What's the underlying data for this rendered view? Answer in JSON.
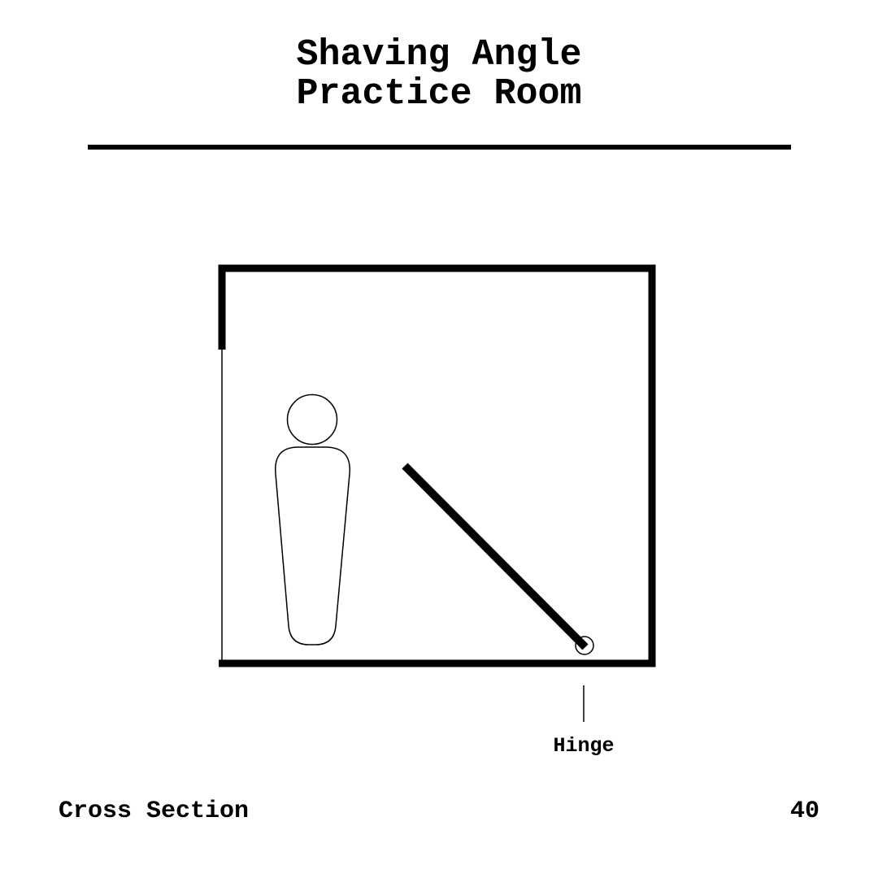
{
  "title": {
    "line1": "Shaving Angle",
    "line2": "Practice Room"
  },
  "diagram": {
    "hinge_label": "Hinge"
  },
  "footer": {
    "caption": "Cross Section",
    "page_number": "40"
  }
}
